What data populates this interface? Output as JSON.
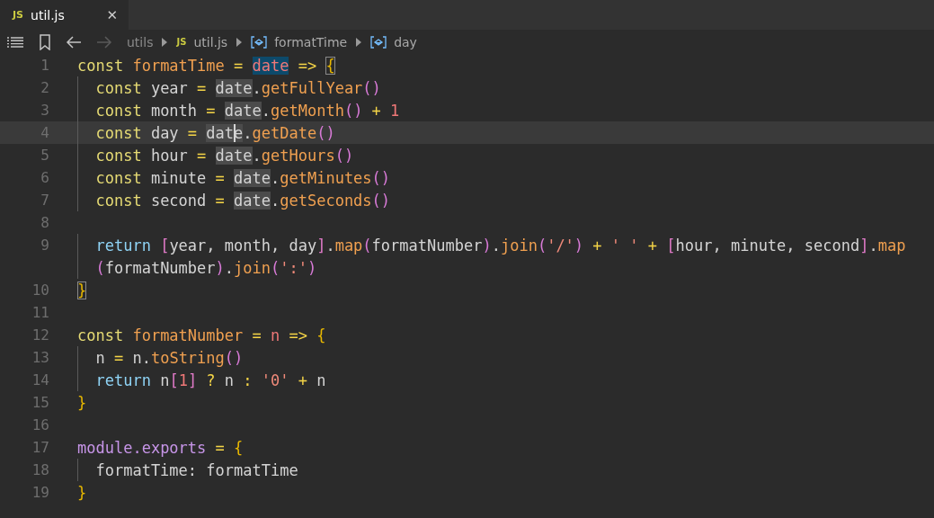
{
  "tabs": [
    {
      "icon_text": "JS",
      "label": "util.js",
      "selected": true,
      "close": "✕"
    }
  ],
  "nav": [
    {
      "kind": "back",
      "disabled": false
    },
    {
      "kind": "forward",
      "disabled": true
    }
  ],
  "breadcrumbs": [
    {
      "kind": "folder",
      "label": "utils"
    },
    {
      "kind": "file",
      "icon_text": "JS",
      "label": "util.js"
    },
    {
      "kind": "symbol",
      "label": "formatTime"
    },
    {
      "kind": "symbol",
      "label": "day"
    }
  ],
  "lines": [
    {
      "number": "1",
      "current": false,
      "tokens": [
        {
          "text": "const ",
          "kind": "kw"
        },
        {
          "text": "formatTime",
          "kind": "fn"
        },
        {
          "text": " = ",
          "kind": "op"
        },
        {
          "text": "date",
          "kind": "param",
          "selection": true
        },
        {
          "text": " => ",
          "kind": "op"
        },
        {
          "text": "{",
          "kind": "brace",
          "matched": true
        }
      ]
    },
    {
      "number": "2",
      "current": false,
      "tokens": [
        {
          "text": "  const ",
          "kind": "kw"
        },
        {
          "text": "year",
          "kind": "plain"
        },
        {
          "text": " = ",
          "kind": "op"
        },
        {
          "text": "date",
          "kind": "plain",
          "occurrence": true
        },
        {
          "text": ".",
          "kind": "plain"
        },
        {
          "text": "getFullYear",
          "kind": "fn"
        },
        {
          "text": "()",
          "kind": "paren"
        }
      ]
    },
    {
      "number": "3",
      "current": false,
      "tokens": [
        {
          "text": "  const ",
          "kind": "kw"
        },
        {
          "text": "month",
          "kind": "plain"
        },
        {
          "text": " = ",
          "kind": "op"
        },
        {
          "text": "date",
          "kind": "plain",
          "occurrence": true
        },
        {
          "text": ".",
          "kind": "plain"
        },
        {
          "text": "getMonth",
          "kind": "fn"
        },
        {
          "text": "()",
          "kind": "paren"
        },
        {
          "text": " + ",
          "kind": "op"
        },
        {
          "text": "1",
          "kind": "num"
        }
      ]
    },
    {
      "number": "4",
      "current": true,
      "tokens": [
        {
          "text": "  const ",
          "kind": "kw"
        },
        {
          "text": "day",
          "kind": "plain"
        },
        {
          "text": " = ",
          "kind": "op"
        },
        {
          "text": "dat",
          "kind": "plain",
          "occurrence": true
        },
        {
          "text": "e",
          "kind": "plain",
          "occurrence": true,
          "caret": true
        },
        {
          "text": ".",
          "kind": "plain"
        },
        {
          "text": "getDate",
          "kind": "fn"
        },
        {
          "text": "()",
          "kind": "paren"
        }
      ]
    },
    {
      "number": "5",
      "current": false,
      "tokens": [
        {
          "text": "  const ",
          "kind": "kw"
        },
        {
          "text": "hour",
          "kind": "plain"
        },
        {
          "text": " = ",
          "kind": "op"
        },
        {
          "text": "date",
          "kind": "plain",
          "occurrence": true
        },
        {
          "text": ".",
          "kind": "plain"
        },
        {
          "text": "getHours",
          "kind": "fn"
        },
        {
          "text": "()",
          "kind": "paren"
        }
      ]
    },
    {
      "number": "6",
      "current": false,
      "tokens": [
        {
          "text": "  const ",
          "kind": "kw"
        },
        {
          "text": "minute",
          "kind": "plain"
        },
        {
          "text": " = ",
          "kind": "op"
        },
        {
          "text": "date",
          "kind": "plain",
          "occurrence": true
        },
        {
          "text": ".",
          "kind": "plain"
        },
        {
          "text": "getMinutes",
          "kind": "fn"
        },
        {
          "text": "()",
          "kind": "paren"
        }
      ]
    },
    {
      "number": "7",
      "current": false,
      "tokens": [
        {
          "text": "  const ",
          "kind": "kw"
        },
        {
          "text": "second",
          "kind": "plain"
        },
        {
          "text": " = ",
          "kind": "op"
        },
        {
          "text": "date",
          "kind": "plain",
          "occurrence": true
        },
        {
          "text": ".",
          "kind": "plain"
        },
        {
          "text": "getSeconds",
          "kind": "fn"
        },
        {
          "text": "()",
          "kind": "paren"
        }
      ]
    },
    {
      "number": "8",
      "current": false
    },
    {
      "number": "9",
      "current": false,
      "tokens": [
        {
          "text": "  return ",
          "kind": "ret"
        },
        {
          "text": "[",
          "kind": "bracket"
        },
        {
          "text": "year, month, day",
          "kind": "plain"
        },
        {
          "text": "]",
          "kind": "bracket"
        },
        {
          "text": ".",
          "kind": "plain"
        },
        {
          "text": "map",
          "kind": "fn"
        },
        {
          "text": "(",
          "kind": "paren"
        },
        {
          "text": "formatNumber",
          "kind": "plain"
        },
        {
          "text": ")",
          "kind": "paren"
        },
        {
          "text": ".",
          "kind": "plain"
        },
        {
          "text": "join",
          "kind": "fn"
        },
        {
          "text": "(",
          "kind": "paren"
        },
        {
          "text": "'/'",
          "kind": "str"
        },
        {
          "text": ")",
          "kind": "paren"
        },
        {
          "text": " + ",
          "kind": "op"
        },
        {
          "text": "' '",
          "kind": "str"
        },
        {
          "text": " + ",
          "kind": "op"
        },
        {
          "text": "[",
          "kind": "bracket"
        },
        {
          "text": "hour, minute, second",
          "kind": "plain"
        },
        {
          "text": "]",
          "kind": "bracket"
        },
        {
          "text": ".",
          "kind": "plain"
        },
        {
          "text": "map",
          "kind": "fn"
        }
      ],
      "wrap": [
        {
          "text": "  (",
          "kind": "paren"
        },
        {
          "text": "formatNumber",
          "kind": "plain"
        },
        {
          "text": ")",
          "kind": "paren"
        },
        {
          "text": ".",
          "kind": "plain"
        },
        {
          "text": "join",
          "kind": "fn"
        },
        {
          "text": "(",
          "kind": "paren"
        },
        {
          "text": "':'",
          "kind": "str"
        },
        {
          "text": ")",
          "kind": "paren"
        }
      ]
    },
    {
      "number": "10",
      "current": false,
      "tokens": [
        {
          "text": "}",
          "kind": "brace",
          "matched": true
        }
      ]
    },
    {
      "number": "11",
      "current": false
    },
    {
      "number": "12",
      "current": false,
      "tokens": [
        {
          "text": "const ",
          "kind": "kw"
        },
        {
          "text": "formatNumber",
          "kind": "fn"
        },
        {
          "text": " = ",
          "kind": "op"
        },
        {
          "text": "n",
          "kind": "param"
        },
        {
          "text": " => ",
          "kind": "op"
        },
        {
          "text": "{",
          "kind": "brace"
        }
      ]
    },
    {
      "number": "13",
      "current": false,
      "tokens": [
        {
          "text": "  n",
          "kind": "plain"
        },
        {
          "text": " = ",
          "kind": "op"
        },
        {
          "text": "n.",
          "kind": "plain"
        },
        {
          "text": "toString",
          "kind": "fn"
        },
        {
          "text": "()",
          "kind": "paren"
        }
      ]
    },
    {
      "number": "14",
      "current": false,
      "tokens": [
        {
          "text": "  return ",
          "kind": "ret"
        },
        {
          "text": "n",
          "kind": "plain"
        },
        {
          "text": "[",
          "kind": "bracket"
        },
        {
          "text": "1",
          "kind": "num"
        },
        {
          "text": "]",
          "kind": "bracket"
        },
        {
          "text": " ? ",
          "kind": "op"
        },
        {
          "text": "n",
          "kind": "plain"
        },
        {
          "text": " : ",
          "kind": "op"
        },
        {
          "text": "'0'",
          "kind": "str"
        },
        {
          "text": " + ",
          "kind": "op"
        },
        {
          "text": "n",
          "kind": "plain"
        }
      ]
    },
    {
      "number": "15",
      "current": false,
      "tokens": [
        {
          "text": "}",
          "kind": "brace"
        }
      ]
    },
    {
      "number": "16",
      "current": false
    },
    {
      "number": "17",
      "current": false,
      "tokens": [
        {
          "text": "module",
          "kind": "module"
        },
        {
          "text": ".exports",
          "kind": "module"
        },
        {
          "text": " = ",
          "kind": "op"
        },
        {
          "text": "{",
          "kind": "brace"
        }
      ]
    },
    {
      "number": "18",
      "current": false,
      "tokens": [
        {
          "text": "  formatTime: formatTime",
          "kind": "plain"
        }
      ]
    },
    {
      "number": "19",
      "current": false,
      "tokens": [
        {
          "text": "}",
          "kind": "brace"
        }
      ]
    }
  ]
}
